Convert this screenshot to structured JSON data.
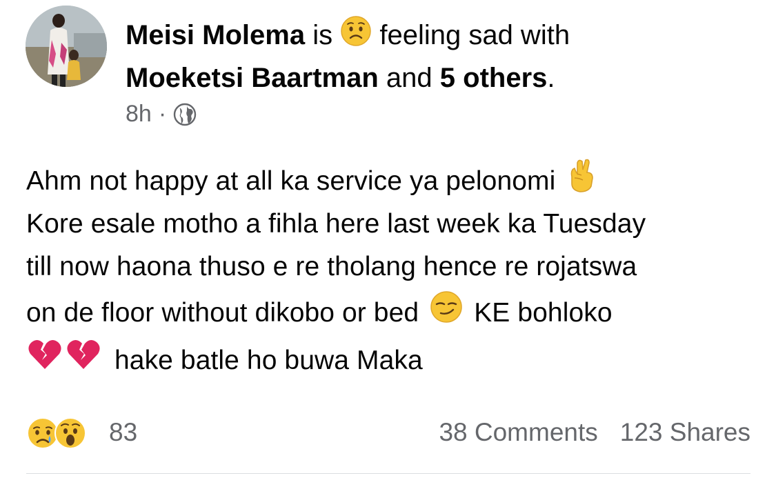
{
  "post": {
    "author": "Meisi Molema",
    "is_word": "is",
    "feeling_text": "feeling sad with",
    "tagged_person": "Moeketsi Baartman",
    "and_word": "and",
    "others": "5 others",
    "period": ".",
    "time": "8h",
    "dot": "·",
    "body_lines": {
      "l1": "Ahm not happy at all ka service ya pelonomi",
      "l2": "Kore esale motho a fihla here last week ka Tuesday",
      "l3": "till now haona thuso e re tholang hence re rojatswa",
      "l4a": "on de floor without dikobo or bed",
      "l4b": "KE bohloko",
      "l5": "hake batle ho buwa Maka"
    }
  },
  "footer": {
    "reaction_count": "83",
    "comments": "38 Comments",
    "shares": "123 Shares"
  },
  "icons": {
    "feeling": "sad-face-icon",
    "audience": "globe-icon",
    "crossed_fingers": "crossed-fingers-icon",
    "smirk": "smirking-face-icon",
    "broken_heart": "broken-heart-icon",
    "reactions": [
      "sad-reaction-icon",
      "wow-reaction-icon"
    ]
  },
  "colors": {
    "text": "#050505",
    "secondary": "#65676b",
    "emoji_yellow": "#f7c535",
    "heart_red": "#e0245e"
  }
}
